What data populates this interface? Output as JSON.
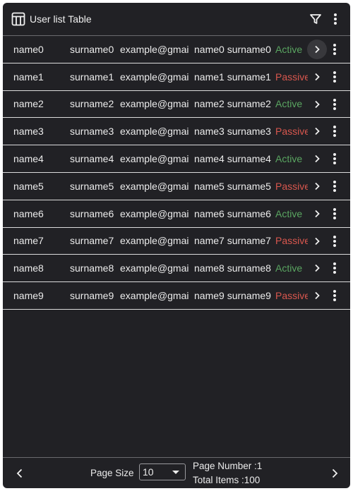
{
  "header": {
    "title": "User list Table",
    "title_icon": "table-icon",
    "filter_icon": "filter-icon",
    "menu_icon": "more-vert-icon"
  },
  "rows": [
    {
      "name": "name0",
      "surname": "surname0",
      "email": "example@gmai",
      "full_name": "name0 surname0",
      "status": "Active"
    },
    {
      "name": "name1",
      "surname": "surname1",
      "email": "example@gmai",
      "full_name": "name1 surname1",
      "status": "Passive"
    },
    {
      "name": "name2",
      "surname": "surname2",
      "email": "example@gmai",
      "full_name": "name2 surname2",
      "status": "Active"
    },
    {
      "name": "name3",
      "surname": "surname3",
      "email": "example@gmai",
      "full_name": "name3 surname3",
      "status": "Passive"
    },
    {
      "name": "name4",
      "surname": "surname4",
      "email": "example@gmai",
      "full_name": "name4 surname4",
      "status": "Active"
    },
    {
      "name": "name5",
      "surname": "surname5",
      "email": "example@gmai",
      "full_name": "name5 surname5",
      "status": "Passive"
    },
    {
      "name": "name6",
      "surname": "surname6",
      "email": "example@gmai",
      "full_name": "name6 surname6",
      "status": "Active"
    },
    {
      "name": "name7",
      "surname": "surname7",
      "email": "example@gmai",
      "full_name": "name7 surname7",
      "status": "Passive"
    },
    {
      "name": "name8",
      "surname": "surname8",
      "email": "example@gmai",
      "full_name": "name8 surname8",
      "status": "Active"
    },
    {
      "name": "name9",
      "surname": "surname9",
      "email": "example@gmai",
      "full_name": "name9 surname9",
      "status": "Passive"
    }
  ],
  "footer": {
    "page_size_label": "Page Size",
    "page_size_value": "10",
    "page_number": "Page Number :1",
    "total_items": "Total Items :100"
  },
  "colors": {
    "background": "#212125",
    "active": "#5aa561",
    "passive": "#d9574e"
  }
}
